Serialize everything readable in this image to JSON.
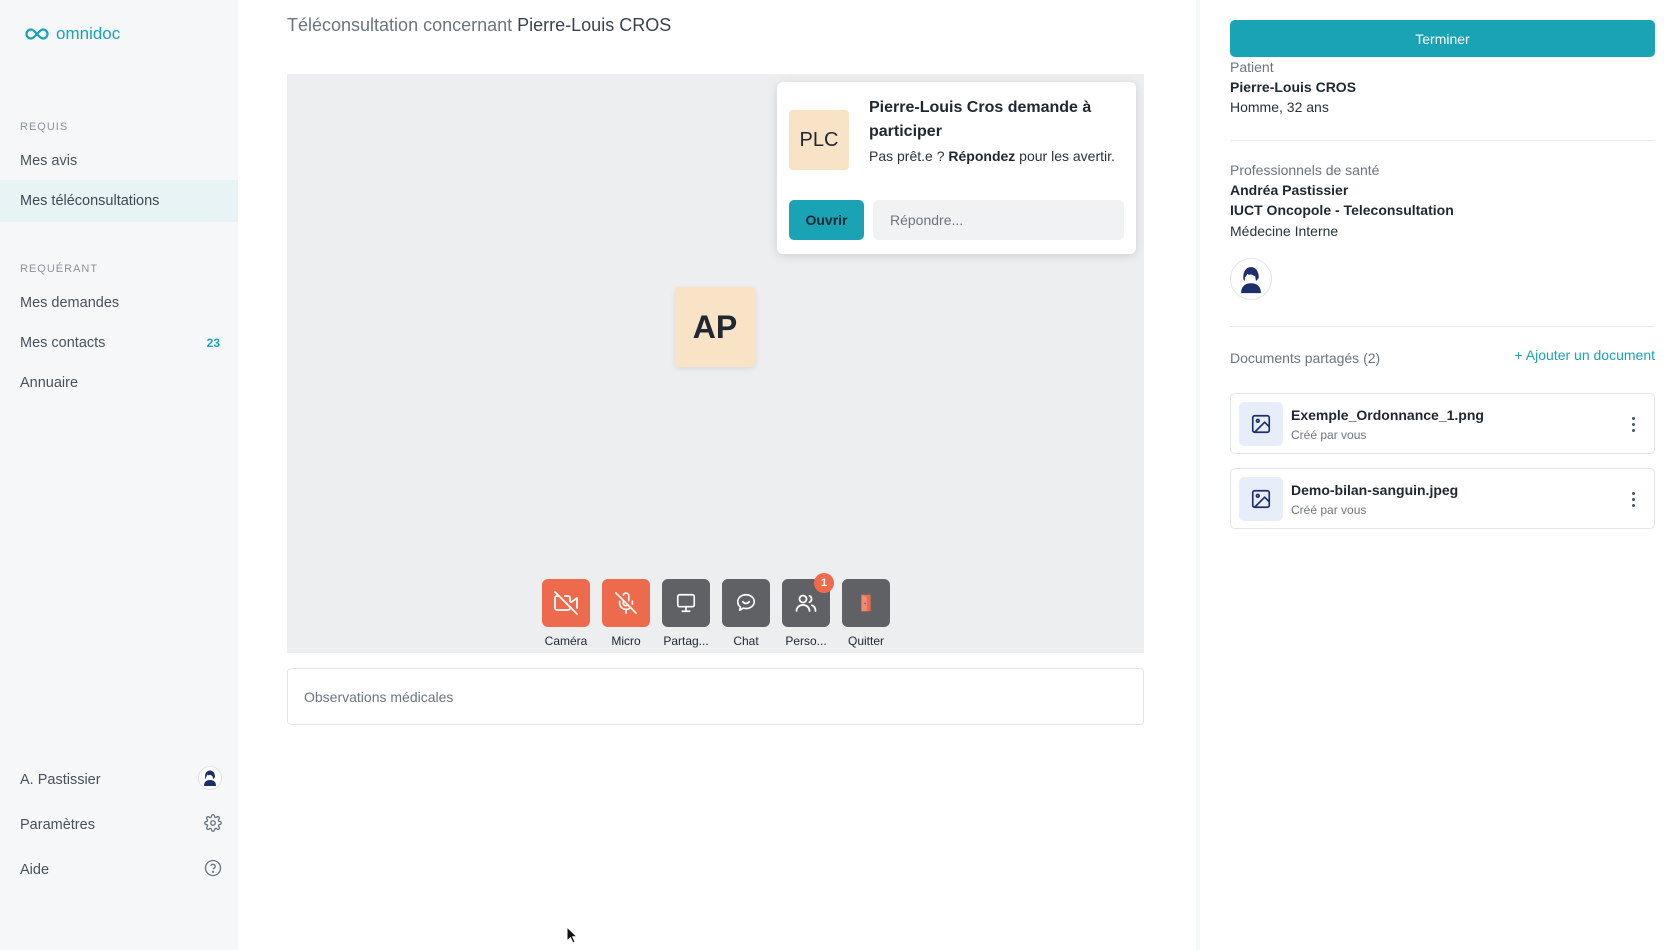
{
  "brand": {
    "name": "omnidoc"
  },
  "sidebar": {
    "sections": [
      {
        "label": "REQUIS",
        "items": [
          {
            "label": "Mes avis"
          },
          {
            "label": "Mes téléconsultations"
          }
        ]
      },
      {
        "label": "REQUÉRANT",
        "items": [
          {
            "label": "Mes demandes"
          },
          {
            "label": "Mes contacts",
            "count": "23"
          },
          {
            "label": "Annuaire"
          }
        ]
      }
    ],
    "footer": {
      "user": "A. Pastissier",
      "settings": "Paramètres",
      "help": "Aide"
    }
  },
  "header": {
    "prefix": "Téléconsultation concernant",
    "patient": "Pierre-Louis CROS"
  },
  "video": {
    "self_initials": "AP",
    "join_request": {
      "initials": "PLC",
      "title": "Pierre-Louis Cros demande à participer",
      "msg_before": "Pas prêt.e ? ",
      "msg_bold": "Répondez",
      "msg_after": " pour les avertir.",
      "open_label": "Ouvrir",
      "reply_placeholder": "Répondre..."
    },
    "controls": [
      {
        "label": "Caméra",
        "icon": "camera-off-icon"
      },
      {
        "label": "Micro",
        "icon": "mic-off-icon"
      },
      {
        "label": "Partag...",
        "icon": "screen-share-icon"
      },
      {
        "label": "Chat",
        "icon": "chat-icon"
      },
      {
        "label": "Perso...",
        "icon": "people-icon",
        "badge": "1"
      },
      {
        "label": "Quitter",
        "icon": "exit-door-icon"
      }
    ]
  },
  "observations": {
    "placeholder": "Observations médicales"
  },
  "panel": {
    "end_label": "Terminer",
    "patient_label": "Patient",
    "patient_name": "Pierre-Louis CROS",
    "patient_info": "Homme, 32 ans",
    "pros_label": "Professionnels de santé",
    "pro_name": "Andréa Pastissier",
    "pro_org": "IUCT Oncopole - Teleconsultation",
    "pro_specialty": "Médecine Interne",
    "docs_label": "Documents partagés (2)",
    "add_doc_label": "Ajouter un document",
    "documents": [
      {
        "name": "Exemple_Ordonnance_1.png",
        "meta": "Créé par vous"
      },
      {
        "name": "Demo-bilan-sanguin.jpeg",
        "meta": "Créé par vous"
      }
    ]
  },
  "colors": {
    "accent": "#1aa3b5",
    "danger": "#ee6a4d",
    "control_grey": "#5f6164",
    "avatar_bg": "#f8e3c6"
  }
}
